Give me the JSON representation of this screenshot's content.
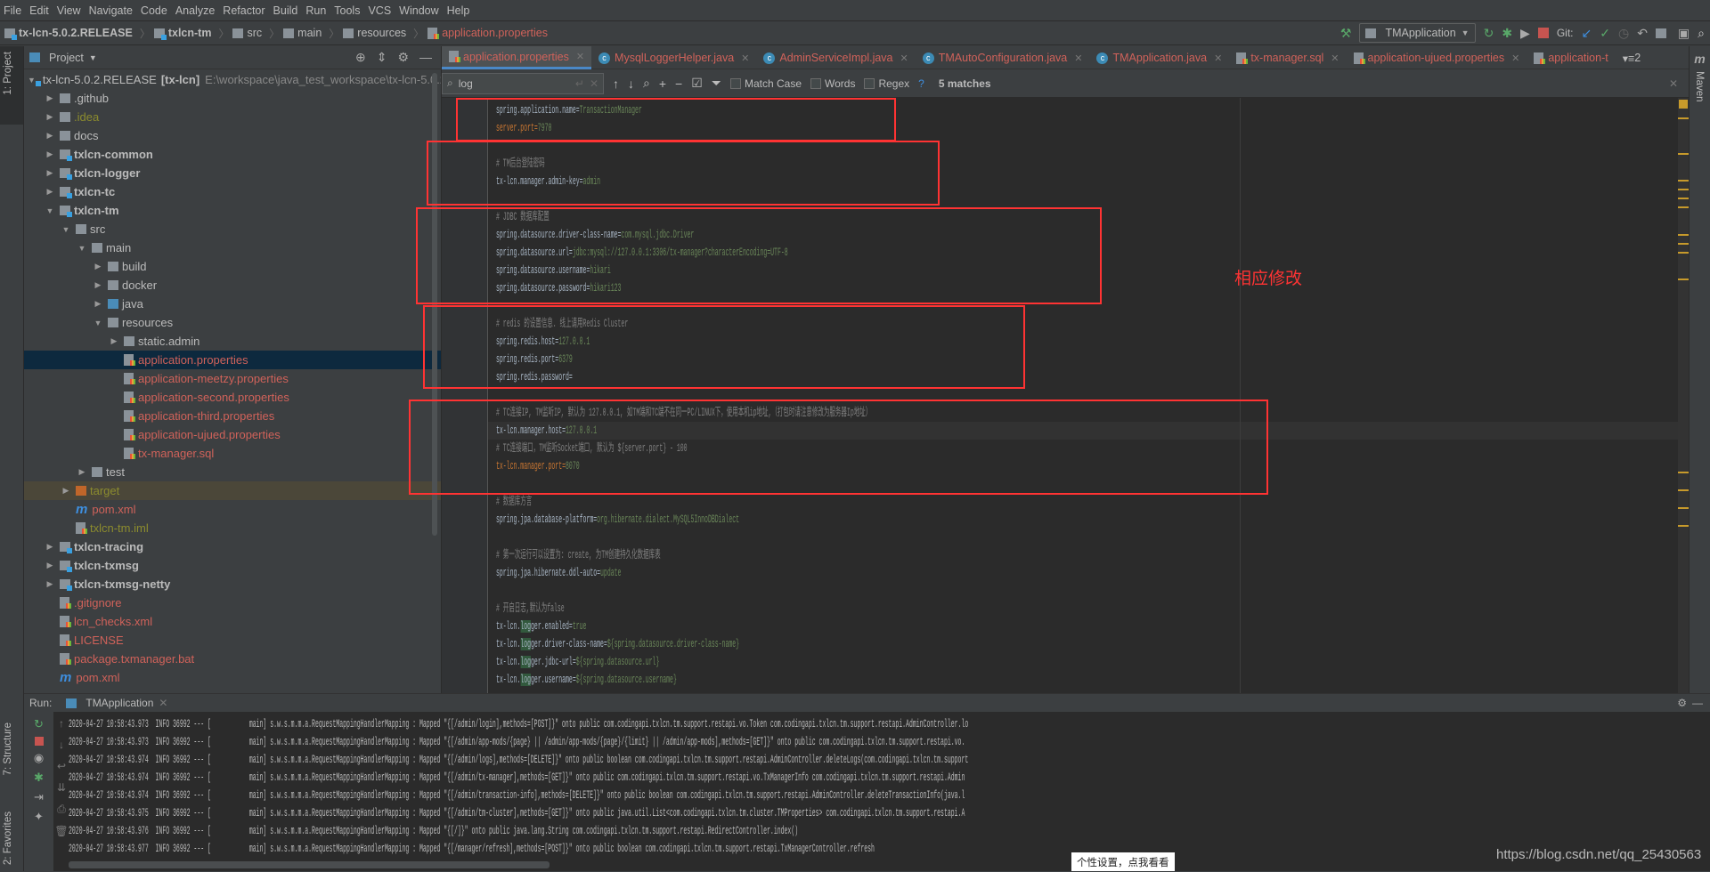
{
  "menu": [
    "File",
    "Edit",
    "View",
    "Navigate",
    "Code",
    "Analyze",
    "Refactor",
    "Build",
    "Run",
    "Tools",
    "VCS",
    "Window",
    "Help"
  ],
  "breadcrumb": [
    "tx-lcn-5.0.2.RELEASE",
    "txlcn-tm",
    "src",
    "main",
    "resources",
    "application.properties"
  ],
  "toolbar": {
    "run_config": "TMApplication",
    "git_label": "Git:"
  },
  "left_strip": {
    "project": "1: Project",
    "structure": "7: Structure",
    "favorites": "2: Favorites"
  },
  "right_strip": {
    "maven": "Maven"
  },
  "project": {
    "title": "Project",
    "tree": [
      {
        "label": "tx-lcn-5.0.2.RELEASE",
        "suffix": "[tx-lcn]",
        "path": "E:\\workspace\\java_test_workspace\\tx-lcn-5.0.2",
        "depth": 0,
        "arrow": "down",
        "icon": "module",
        "color": "#bbbbbb"
      },
      {
        "label": ".github",
        "depth": 1,
        "arrow": "right",
        "icon": "folder",
        "color": "#bbbbbb"
      },
      {
        "label": ".idea",
        "depth": 1,
        "arrow": "right",
        "icon": "folder",
        "color": "#8c8c2e"
      },
      {
        "label": "docs",
        "depth": 1,
        "arrow": "right",
        "icon": "folder",
        "color": "#bbbbbb"
      },
      {
        "label": "txlcn-common",
        "depth": 1,
        "arrow": "right",
        "icon": "module",
        "color": "#bbbbbb",
        "bold": true
      },
      {
        "label": "txlcn-logger",
        "depth": 1,
        "arrow": "right",
        "icon": "module",
        "color": "#bbbbbb",
        "bold": true
      },
      {
        "label": "txlcn-tc",
        "depth": 1,
        "arrow": "right",
        "icon": "module",
        "color": "#bbbbbb",
        "bold": true
      },
      {
        "label": "txlcn-tm",
        "depth": 1,
        "arrow": "down",
        "icon": "module",
        "color": "#bbbbbb",
        "bold": true
      },
      {
        "label": "src",
        "depth": 2,
        "arrow": "down",
        "icon": "folder",
        "color": "#bbbbbb"
      },
      {
        "label": "main",
        "depth": 3,
        "arrow": "down",
        "icon": "folder",
        "color": "#bbbbbb"
      },
      {
        "label": "build",
        "depth": 4,
        "arrow": "right",
        "icon": "folder",
        "color": "#bbbbbb"
      },
      {
        "label": "docker",
        "depth": 4,
        "arrow": "right",
        "icon": "folder",
        "color": "#bbbbbb"
      },
      {
        "label": "java",
        "depth": 4,
        "arrow": "right",
        "icon": "folder-blue",
        "color": "#bbbbbb"
      },
      {
        "label": "resources",
        "depth": 4,
        "arrow": "down",
        "icon": "folder-resources",
        "color": "#bbbbbb"
      },
      {
        "label": "static.admin",
        "depth": 5,
        "arrow": "right",
        "icon": "folder",
        "color": "#bbbbbb"
      },
      {
        "label": "application.properties",
        "depth": 5,
        "arrow": "",
        "icon": "properties",
        "color": "#d0625a",
        "selected": true
      },
      {
        "label": "application-meetzy.properties",
        "depth": 5,
        "arrow": "",
        "icon": "properties",
        "color": "#d0625a"
      },
      {
        "label": "application-second.properties",
        "depth": 5,
        "arrow": "",
        "icon": "properties",
        "color": "#d0625a"
      },
      {
        "label": "application-third.properties",
        "depth": 5,
        "arrow": "",
        "icon": "properties",
        "color": "#d0625a"
      },
      {
        "label": "application-ujued.properties",
        "depth": 5,
        "arrow": "",
        "icon": "properties",
        "color": "#d0625a"
      },
      {
        "label": "tx-manager.sql",
        "depth": 5,
        "arrow": "",
        "icon": "sql",
        "color": "#d0625a"
      },
      {
        "label": "test",
        "depth": 3,
        "arrow": "right",
        "icon": "folder",
        "color": "#bbbbbb"
      },
      {
        "label": "target",
        "depth": 2,
        "arrow": "right",
        "icon": "folder-orange",
        "color": "#8c8c2e",
        "excluded": true
      },
      {
        "label": "pom.xml",
        "depth": 2,
        "arrow": "",
        "icon": "maven",
        "color": "#d0625a"
      },
      {
        "label": "txlcn-tm.iml",
        "depth": 2,
        "arrow": "",
        "icon": "file",
        "color": "#8c8c2e"
      },
      {
        "label": "txlcn-tracing",
        "depth": 1,
        "arrow": "right",
        "icon": "module",
        "color": "#bbbbbb",
        "bold": true
      },
      {
        "label": "txlcn-txmsg",
        "depth": 1,
        "arrow": "right",
        "icon": "module",
        "color": "#bbbbbb",
        "bold": true
      },
      {
        "label": "txlcn-txmsg-netty",
        "depth": 1,
        "arrow": "right",
        "icon": "module",
        "color": "#bbbbbb",
        "bold": true
      },
      {
        "label": ".gitignore",
        "depth": 1,
        "arrow": "",
        "icon": "file",
        "color": "#d0625a"
      },
      {
        "label": "lcn_checks.xml",
        "depth": 1,
        "arrow": "",
        "icon": "xml",
        "color": "#d0625a"
      },
      {
        "label": "LICENSE",
        "depth": 1,
        "arrow": "",
        "icon": "text",
        "color": "#d0625a"
      },
      {
        "label": "package.txmanager.bat",
        "depth": 1,
        "arrow": "",
        "icon": "text",
        "color": "#d0625a"
      },
      {
        "label": "pom.xml",
        "depth": 1,
        "arrow": "",
        "icon": "maven",
        "color": "#d0625a"
      }
    ]
  },
  "tabs": [
    {
      "label": "application.properties",
      "icon": "properties",
      "active": true
    },
    {
      "label": "MysqlLoggerHelper.java",
      "icon": "class"
    },
    {
      "label": "AdminServiceImpl.java",
      "icon": "class"
    },
    {
      "label": "TMAutoConfiguration.java",
      "icon": "class"
    },
    {
      "label": "TMApplication.java",
      "icon": "class"
    },
    {
      "label": "tx-manager.sql",
      "icon": "sql"
    },
    {
      "label": "application-ujued.properties",
      "icon": "properties"
    },
    {
      "label": "application-t",
      "icon": "properties"
    }
  ],
  "tabs_overflow": "2",
  "find": {
    "query": "log",
    "match_case": "Match Case",
    "words": "Words",
    "regex": "Regex",
    "help": "?",
    "matches": "5 matches"
  },
  "code": {
    "current_line": 19,
    "lines": [
      {
        "k": "spring.application.name=",
        "v": "TransactionManager"
      },
      {
        "k": "server.port=",
        "v": "7970",
        "mod": true
      },
      {},
      {
        "c": "# TM后台登陆密码"
      },
      {
        "k": "tx-lcn.manager.admin-key=",
        "v": "admin"
      },
      {},
      {
        "c": "# JDBC 数据库配置"
      },
      {
        "k": "spring.datasource.driver-class-name=",
        "v": "com.mysql.jdbc.Driver"
      },
      {
        "k": "spring.datasource.url=",
        "v": "jdbc:mysql://127.0.0.1:3306/tx-manager?characterEncoding=UTF-8"
      },
      {
        "k": "spring.datasource.username=",
        "v": "hikari"
      },
      {
        "k": "spring.datasource.password=",
        "v": "hikari123"
      },
      {},
      {
        "c": "# redis 的设置信息. 线上请用Redis Cluster"
      },
      {
        "k": "spring.redis.host=",
        "v": "127.0.0.1"
      },
      {
        "k": "spring.redis.port=",
        "v": "6379"
      },
      {
        "k": "spring.redis.password=",
        "v": ""
      },
      {},
      {
        "c": "# TC连接IP, TM监听IP, 默认为 127.0.0.1, 如TM端和TC端不在同一PC/LINUX下，使用本机ip地址,（打包时请注意修改为服务器Ip地址）"
      },
      {
        "k": "tx-lcn.manager.host=",
        "v": "127.0.0.1"
      },
      {
        "c": "# TC连接端口，TM监听Socket端口, 默认为 ${server.port} - 100"
      },
      {
        "k": "tx-lcn.manager.port=",
        "v": "8070",
        "mod": true
      },
      {},
      {
        "c": "# 数据库方言"
      },
      {
        "k": "spring.jpa.database-platform=",
        "v": "org.hibernate.dialect.MySQL5InnoDBDialect"
      },
      {},
      {
        "c": "# 第一次运行可以设置为: create, 为TM创建持久化数据库表"
      },
      {
        "k": "spring.jpa.hibernate.ddl-auto=",
        "v": "update"
      },
      {},
      {
        "c": "# 开启日志,默认为false"
      },
      {
        "k": "tx-lcn.logger.enabled=",
        "v": "true"
      },
      {
        "k": "tx-lcn.logger.driver-class-name=",
        "v": "${spring.datasource.driver-class-name}"
      },
      {
        "k": "tx-lcn.logger.jdbc-url=",
        "v": "${spring.datasource.url}"
      },
      {
        "k": "tx-lcn.logger.username=",
        "v": "${spring.datasource.username}"
      }
    ]
  },
  "annotation": "相应修改",
  "colors": {
    "annotation_red": "#ff3333",
    "editor_bg": "#2b2b2b",
    "panel_bg": "#3c3f41",
    "modified_file": "#d0625a"
  },
  "run": {
    "label": "Run:",
    "tab": "TMApplication",
    "log": [
      "2020-04-27 10:58:43.973  INFO 36992 --- [           main] s.w.s.m.m.a.RequestMappingHandlerMapping : Mapped \"{[/admin/exceptions],methods=[POST]}\" onto public boolean com.codingapi.txlcn.tm.support.restapi.AdminController.deleteExceptions(com.codingapi.txlcn",
      "2020-04-27 10:58:43.973  INFO 36992 --- [           main] s.w.s.m.m.a.RequestMappingHandlerMapping : Mapped \"{[/admin/login],methods=[POST]}\" onto public com.codingapi.txlcn.tm.support.restapi.vo.Token com.codingapi.txlcn.tm.support.restapi.AdminController.lo",
      "2020-04-27 10:58:43.973  INFO 36992 --- [           main] s.w.s.m.m.a.RequestMappingHandlerMapping : Mapped \"{[/admin/app-mods/{page} || /admin/app-mods/{page}/{limit} || /admin/app-mods],methods=[GET]}\" onto public com.codingapi.txlcn.tm.support.restapi.vo.",
      "2020-04-27 10:58:43.974  INFO 36992 --- [           main] s.w.s.m.m.a.RequestMappingHandlerMapping : Mapped \"{[/admin/logs],methods=[DELETE]}\" onto public boolean com.codingapi.txlcn.tm.support.restapi.AdminController.deleteLogs(com.codingapi.txlcn.tm.support",
      "2020-04-27 10:58:43.974  INFO 36992 --- [           main] s.w.s.m.m.a.RequestMappingHandlerMapping : Mapped \"{[/admin/tx-manager],methods=[GET]}\" onto public com.codingapi.txlcn.tm.support.restapi.vo.TxManagerInfo com.codingapi.txlcn.tm.support.restapi.Admin",
      "2020-04-27 10:58:43.974  INFO 36992 --- [           main] s.w.s.m.m.a.RequestMappingHandlerMapping : Mapped \"{[/admin/transaction-info],methods=[DELETE]}\" onto public boolean com.codingapi.txlcn.tm.support.restapi.AdminController.deleteTransactionInfo(java.l",
      "2020-04-27 10:58:43.975  INFO 36992 --- [           main] s.w.s.m.m.a.RequestMappingHandlerMapping : Mapped \"{[/admin/tm-cluster],methods=[GET]}\" onto public java.util.List<com.codingapi.txlcn.tm.cluster.TMProperties> com.codingapi.txlcn.tm.support.restapi.A",
      "2020-04-27 10:58:43.976  INFO 36992 --- [           main] s.w.s.m.m.a.RequestMappingHandlerMapping : Mapped \"{[/]}\" onto public java.lang.String com.codingapi.txlcn.tm.support.restapi.RedirectController.index()",
      "2020-04-27 10:58:43.977  INFO 36992 --- [           main] s.w.s.m.m.a.RequestMappingHandlerMapping : Mapped \"{[/manager/refresh],methods=[POST]}\" onto public boolean com.codingapi.txlcn.tm.support.restapi.TxManagerController.refresh"
    ]
  },
  "watermark": "https://blog.csdn.net/qq_25430563",
  "tooltip": "个性设置，点我看看"
}
